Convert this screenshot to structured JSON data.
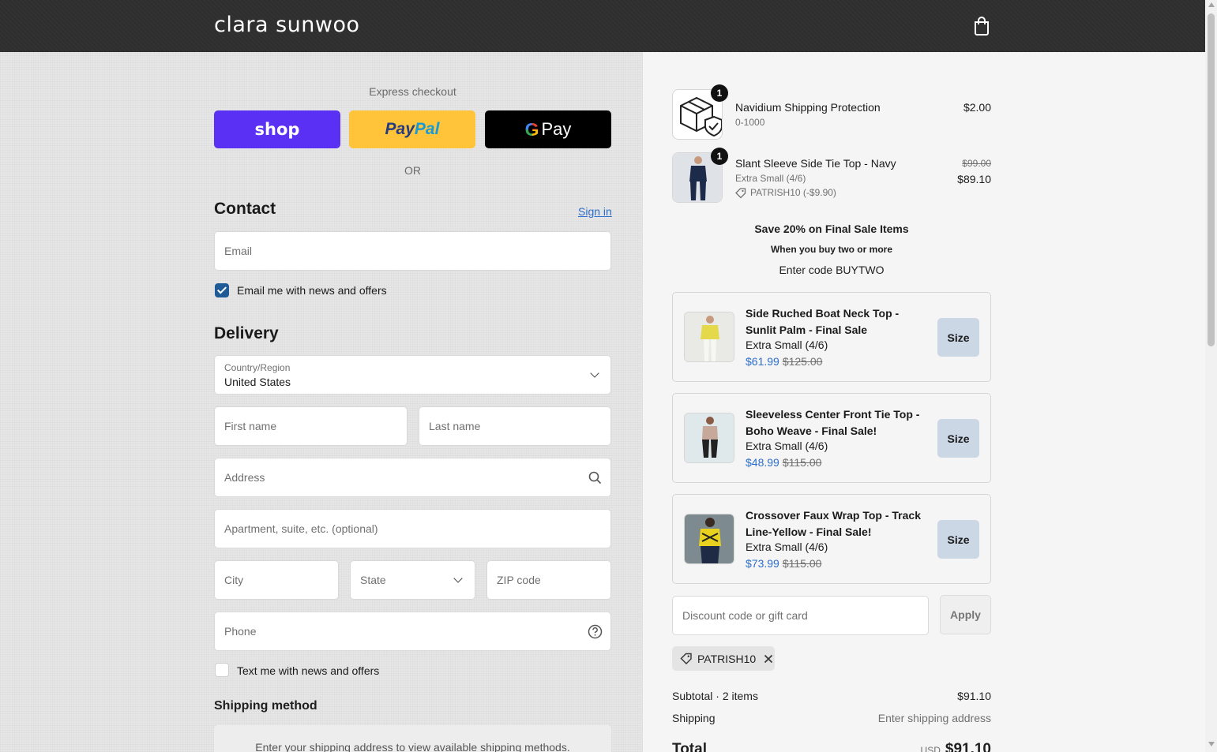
{
  "header": {
    "brand": "clara sunwoo",
    "cart_icon": "shopping-bag-icon"
  },
  "express": {
    "label": "Express checkout",
    "shop_label": "shop",
    "paypal_a": "Pay",
    "paypal_b": "Pal",
    "gpay_g": "G",
    "gpay_label": "Pay",
    "or_label": "OR"
  },
  "contact": {
    "title": "Contact",
    "sign_in": "Sign in",
    "email_placeholder": "Email",
    "email_optin_label": "Email me with news and offers",
    "email_optin_checked": true
  },
  "delivery": {
    "title": "Delivery",
    "country_label": "Country/Region",
    "country_value": "United States",
    "first_name": "First name",
    "last_name": "Last name",
    "address": "Address",
    "apartment": "Apartment, suite, etc. (optional)",
    "city": "City",
    "state": "State",
    "zip": "ZIP code",
    "phone": "Phone",
    "sms_optin_label": "Text me with news and offers",
    "sms_optin_checked": false
  },
  "shipping_method": {
    "title": "Shipping method",
    "message": "Enter your shipping address to view available shipping methods."
  },
  "order": {
    "items": [
      {
        "title": "Navidium Shipping Protection",
        "variant": "0-1000",
        "qty": "1",
        "price": "$2.00"
      },
      {
        "title": "Slant Sleeve Side Tie Top - Navy",
        "variant": "Extra Small (4/6)",
        "discount": "PATRISH10 (-$9.90)",
        "qty": "1",
        "original_price": "$99.00",
        "price": "$89.10"
      }
    ],
    "promo": {
      "headline": "Save 20% on Final Sale Items",
      "sub": "When you buy two or more",
      "code_line": "Enter code BUYTWO"
    },
    "upsells": [
      {
        "title": "Side Ruched Boat Neck Top - Sunlit Palm - Final Sale",
        "size": "Extra Small (4/6)",
        "price": "$61.99",
        "compare": "$125.00",
        "button": "Size"
      },
      {
        "title": "Sleeveless Center Front Tie Top - Boho Weave - Final Sale!",
        "size": "Extra Small (4/6)",
        "price": "$48.99",
        "compare": "$115.00",
        "button": "Size"
      },
      {
        "title": "Crossover Faux Wrap Top - Track Line-Yellow - Final Sale!",
        "size": "Extra Small (4/6)",
        "price": "$73.99",
        "compare": "$115.00",
        "button": "Size"
      }
    ],
    "discount_placeholder": "Discount code or gift card",
    "apply_label": "Apply",
    "applied_code": "PATRISH10",
    "subtotal_label": "Subtotal · 2 items",
    "subtotal_value": "$91.10",
    "shipping_label": "Shipping",
    "shipping_value": "Enter shipping address",
    "total_label": "Total",
    "currency": "USD",
    "total_value": "$91.10"
  }
}
